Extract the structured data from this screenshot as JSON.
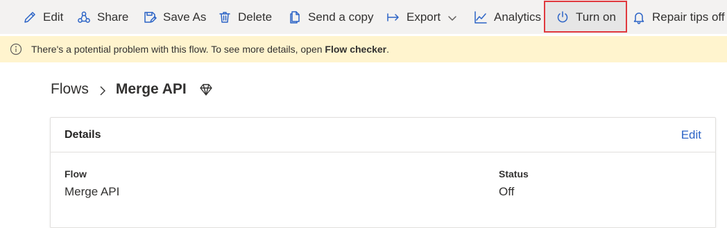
{
  "toolbar": {
    "items": [
      {
        "label": "Edit",
        "icon": "pencil-icon"
      },
      {
        "label": "Share",
        "icon": "share-icon"
      },
      {
        "label": "Save As",
        "icon": "save-as-icon"
      },
      {
        "label": "Delete",
        "icon": "trash-icon"
      },
      {
        "label": "Send a copy",
        "icon": "copy-icon"
      },
      {
        "label": "Export",
        "icon": "export-icon"
      },
      {
        "label": "Analytics",
        "icon": "analytics-icon"
      },
      {
        "label": "Turn on",
        "icon": "power-icon"
      },
      {
        "label": "Repair tips off",
        "icon": "bell-icon"
      }
    ],
    "highlight_color": "#e0393e",
    "accent_color": "#2b63c6"
  },
  "banner": {
    "message": "There's a potential problem with this flow. To see more details, open ",
    "link": "Flow checker",
    "suffix": ".",
    "background": "#fff4ce"
  },
  "breadcrumb": {
    "root": "Flows",
    "current": "Merge API"
  },
  "details": {
    "title": "Details",
    "edit_label": "Edit",
    "flow_label": "Flow",
    "flow_value": "Merge API",
    "status_label": "Status",
    "status_value": "Off"
  }
}
